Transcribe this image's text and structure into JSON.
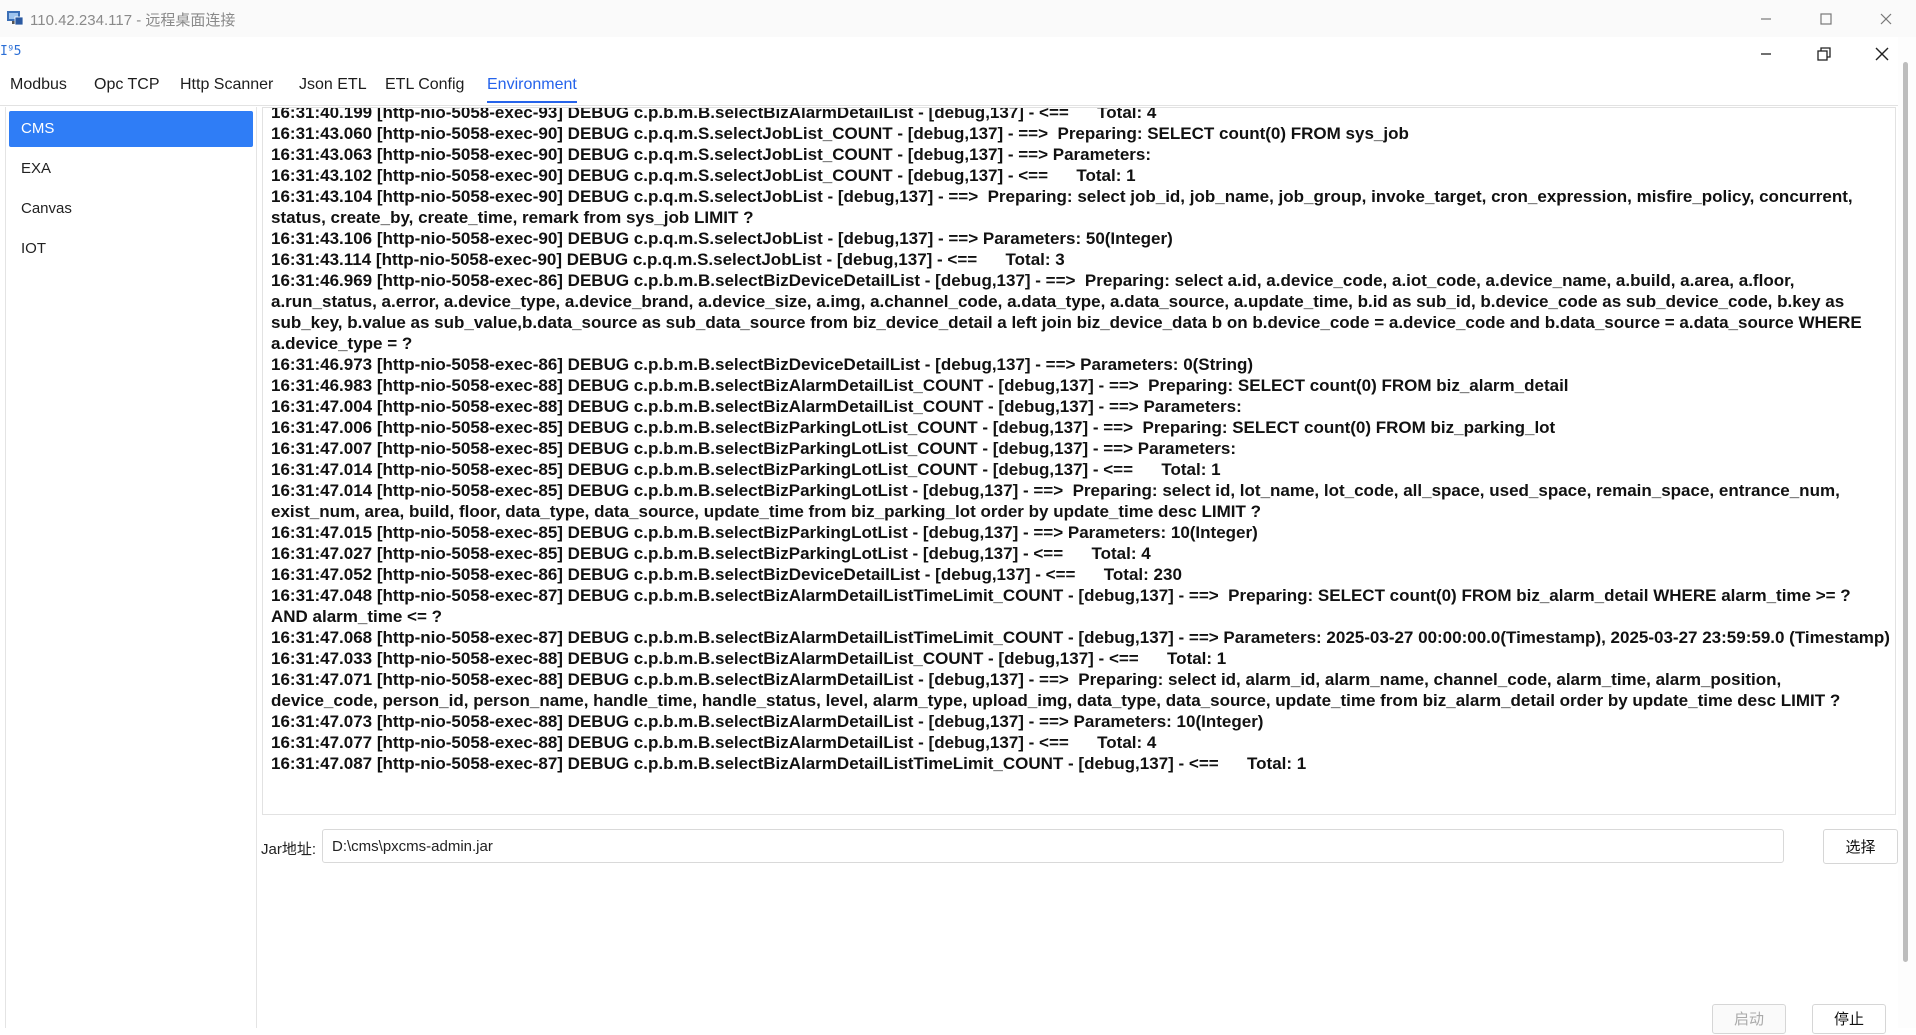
{
  "rdp": {
    "title": "110.42.234.117 - 远程桌面连接"
  },
  "app": {
    "logo_text": "I⁹5"
  },
  "tabs": [
    "Modbus",
    "Opc TCP",
    "Http Scanner",
    "Json ETL",
    "ETL Config",
    "Environment"
  ],
  "active_tab": "Environment",
  "sidebar": {
    "items": [
      "CMS",
      "EXA",
      "Canvas",
      "IOT"
    ],
    "active": "CMS"
  },
  "log": {
    "lines": [
      "16:31:40.199 [http-nio-5058-exec-93] DEBUG c.p.b.m.B.selectBizAlarmDetailList - [debug,137] - <==      Total: 4",
      "16:31:43.060 [http-nio-5058-exec-90] DEBUG c.p.q.m.S.selectJobList_COUNT - [debug,137] - ==>  Preparing: SELECT count(0) FROM sys_job",
      "16:31:43.063 [http-nio-5058-exec-90] DEBUG c.p.q.m.S.selectJobList_COUNT - [debug,137] - ==> Parameters:",
      "16:31:43.102 [http-nio-5058-exec-90] DEBUG c.p.q.m.S.selectJobList_COUNT - [debug,137] - <==      Total: 1",
      "16:31:43.104 [http-nio-5058-exec-90] DEBUG c.p.q.m.S.selectJobList - [debug,137] - ==>  Preparing: select job_id, job_name, job_group, invoke_target, cron_expression, misfire_policy, concurrent, status, create_by, create_time, remark from sys_job LIMIT ?",
      "16:31:43.106 [http-nio-5058-exec-90] DEBUG c.p.q.m.S.selectJobList - [debug,137] - ==> Parameters: 50(Integer)",
      "16:31:43.114 [http-nio-5058-exec-90] DEBUG c.p.q.m.S.selectJobList - [debug,137] - <==      Total: 3",
      "16:31:46.969 [http-nio-5058-exec-86] DEBUG c.p.b.m.B.selectBizDeviceDetailList - [debug,137] - ==>  Preparing: select a.id, a.device_code, a.iot_code, a.device_name, a.build, a.area, a.floor, a.run_status, a.error, a.device_type, a.device_brand, a.device_size, a.img, a.channel_code, a.data_type, a.data_source, a.update_time, b.id as sub_id, b.device_code as sub_device_code, b.key as sub_key, b.value as sub_value,b.data_source as sub_data_source from biz_device_detail a left join biz_device_data b on b.device_code = a.device_code and b.data_source = a.data_source WHERE a.device_type = ?",
      "16:31:46.973 [http-nio-5058-exec-86] DEBUG c.p.b.m.B.selectBizDeviceDetailList - [debug,137] - ==> Parameters: 0(String)",
      "16:31:46.983 [http-nio-5058-exec-88] DEBUG c.p.b.m.B.selectBizAlarmDetailList_COUNT - [debug,137] - ==>  Preparing: SELECT count(0) FROM biz_alarm_detail",
      "16:31:47.004 [http-nio-5058-exec-88] DEBUG c.p.b.m.B.selectBizAlarmDetailList_COUNT - [debug,137] - ==> Parameters:",
      "16:31:47.006 [http-nio-5058-exec-85] DEBUG c.p.b.m.B.selectBizParkingLotList_COUNT - [debug,137] - ==>  Preparing: SELECT count(0) FROM biz_parking_lot",
      "16:31:47.007 [http-nio-5058-exec-85] DEBUG c.p.b.m.B.selectBizParkingLotList_COUNT - [debug,137] - ==> Parameters:",
      "16:31:47.014 [http-nio-5058-exec-85] DEBUG c.p.b.m.B.selectBizParkingLotList_COUNT - [debug,137] - <==      Total: 1",
      "16:31:47.014 [http-nio-5058-exec-85] DEBUG c.p.b.m.B.selectBizParkingLotList - [debug,137] - ==>  Preparing: select id, lot_name, lot_code, all_space, used_space, remain_space, entrance_num, exist_num, area, build, floor, data_type, data_source, update_time from biz_parking_lot order by update_time desc LIMIT ?",
      "16:31:47.015 [http-nio-5058-exec-85] DEBUG c.p.b.m.B.selectBizParkingLotList - [debug,137] - ==> Parameters: 10(Integer)",
      "16:31:47.027 [http-nio-5058-exec-85] DEBUG c.p.b.m.B.selectBizParkingLotList - [debug,137] - <==      Total: 4",
      "16:31:47.052 [http-nio-5058-exec-86] DEBUG c.p.b.m.B.selectBizDeviceDetailList - [debug,137] - <==      Total: 230",
      "16:31:47.048 [http-nio-5058-exec-87] DEBUG c.p.b.m.B.selectBizAlarmDetailListTimeLimit_COUNT - [debug,137] - ==>  Preparing: SELECT count(0) FROM biz_alarm_detail WHERE alarm_time >= ? AND alarm_time <= ?",
      "16:31:47.068 [http-nio-5058-exec-87] DEBUG c.p.b.m.B.selectBizAlarmDetailListTimeLimit_COUNT - [debug,137] - ==> Parameters: 2025-03-27 00:00:00.0(Timestamp), 2025-03-27 23:59:59.0 (Timestamp)",
      "16:31:47.033 [http-nio-5058-exec-88] DEBUG c.p.b.m.B.selectBizAlarmDetailList_COUNT - [debug,137] - <==      Total: 1",
      "16:31:47.071 [http-nio-5058-exec-88] DEBUG c.p.b.m.B.selectBizAlarmDetailList - [debug,137] - ==>  Preparing: select id, alarm_id, alarm_name, channel_code, alarm_time, alarm_position, device_code, person_id, person_name, handle_time, handle_status, level, alarm_type, upload_img, data_type, data_source, update_time from biz_alarm_detail order by update_time desc LIMIT ?",
      "16:31:47.073 [http-nio-5058-exec-88] DEBUG c.p.b.m.B.selectBizAlarmDetailList - [debug,137] - ==> Parameters: 10(Integer)",
      "16:31:47.077 [http-nio-5058-exec-88] DEBUG c.p.b.m.B.selectBizAlarmDetailList - [debug,137] - <==      Total: 4",
      "16:31:47.087 [http-nio-5058-exec-87] DEBUG c.p.b.m.B.selectBizAlarmDetailListTimeLimit_COUNT - [debug,137] - <==      Total: 1"
    ]
  },
  "jar": {
    "label": "Jar地址:",
    "value": "D:\\cms\\pxcms-admin.jar",
    "choose_label": "选择"
  },
  "actions": {
    "start_label": "启动",
    "stop_label": "停止"
  }
}
